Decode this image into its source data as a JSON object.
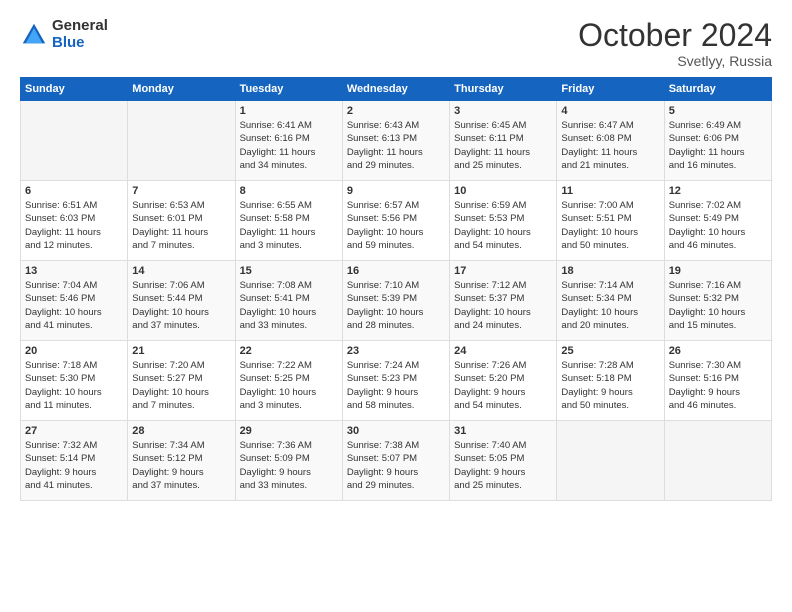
{
  "header": {
    "logo_general": "General",
    "logo_blue": "Blue",
    "month": "October 2024",
    "location": "Svetlyy, Russia"
  },
  "weekdays": [
    "Sunday",
    "Monday",
    "Tuesday",
    "Wednesday",
    "Thursday",
    "Friday",
    "Saturday"
  ],
  "weeks": [
    [
      {
        "day": "",
        "sunrise": "",
        "sunset": "",
        "daylight": ""
      },
      {
        "day": "",
        "sunrise": "",
        "sunset": "",
        "daylight": ""
      },
      {
        "day": "1",
        "sunrise": "Sunrise: 6:41 AM",
        "sunset": "Sunset: 6:16 PM",
        "daylight": "Daylight: 11 hours and 34 minutes."
      },
      {
        "day": "2",
        "sunrise": "Sunrise: 6:43 AM",
        "sunset": "Sunset: 6:13 PM",
        "daylight": "Daylight: 11 hours and 29 minutes."
      },
      {
        "day": "3",
        "sunrise": "Sunrise: 6:45 AM",
        "sunset": "Sunset: 6:11 PM",
        "daylight": "Daylight: 11 hours and 25 minutes."
      },
      {
        "day": "4",
        "sunrise": "Sunrise: 6:47 AM",
        "sunset": "Sunset: 6:08 PM",
        "daylight": "Daylight: 11 hours and 21 minutes."
      },
      {
        "day": "5",
        "sunrise": "Sunrise: 6:49 AM",
        "sunset": "Sunset: 6:06 PM",
        "daylight": "Daylight: 11 hours and 16 minutes."
      }
    ],
    [
      {
        "day": "6",
        "sunrise": "Sunrise: 6:51 AM",
        "sunset": "Sunset: 6:03 PM",
        "daylight": "Daylight: 11 hours and 12 minutes."
      },
      {
        "day": "7",
        "sunrise": "Sunrise: 6:53 AM",
        "sunset": "Sunset: 6:01 PM",
        "daylight": "Daylight: 11 hours and 7 minutes."
      },
      {
        "day": "8",
        "sunrise": "Sunrise: 6:55 AM",
        "sunset": "Sunset: 5:58 PM",
        "daylight": "Daylight: 11 hours and 3 minutes."
      },
      {
        "day": "9",
        "sunrise": "Sunrise: 6:57 AM",
        "sunset": "Sunset: 5:56 PM",
        "daylight": "Daylight: 10 hours and 59 minutes."
      },
      {
        "day": "10",
        "sunrise": "Sunrise: 6:59 AM",
        "sunset": "Sunset: 5:53 PM",
        "daylight": "Daylight: 10 hours and 54 minutes."
      },
      {
        "day": "11",
        "sunrise": "Sunrise: 7:00 AM",
        "sunset": "Sunset: 5:51 PM",
        "daylight": "Daylight: 10 hours and 50 minutes."
      },
      {
        "day": "12",
        "sunrise": "Sunrise: 7:02 AM",
        "sunset": "Sunset: 5:49 PM",
        "daylight": "Daylight: 10 hours and 46 minutes."
      }
    ],
    [
      {
        "day": "13",
        "sunrise": "Sunrise: 7:04 AM",
        "sunset": "Sunset: 5:46 PM",
        "daylight": "Daylight: 10 hours and 41 minutes."
      },
      {
        "day": "14",
        "sunrise": "Sunrise: 7:06 AM",
        "sunset": "Sunset: 5:44 PM",
        "daylight": "Daylight: 10 hours and 37 minutes."
      },
      {
        "day": "15",
        "sunrise": "Sunrise: 7:08 AM",
        "sunset": "Sunset: 5:41 PM",
        "daylight": "Daylight: 10 hours and 33 minutes."
      },
      {
        "day": "16",
        "sunrise": "Sunrise: 7:10 AM",
        "sunset": "Sunset: 5:39 PM",
        "daylight": "Daylight: 10 hours and 28 minutes."
      },
      {
        "day": "17",
        "sunrise": "Sunrise: 7:12 AM",
        "sunset": "Sunset: 5:37 PM",
        "daylight": "Daylight: 10 hours and 24 minutes."
      },
      {
        "day": "18",
        "sunrise": "Sunrise: 7:14 AM",
        "sunset": "Sunset: 5:34 PM",
        "daylight": "Daylight: 10 hours and 20 minutes."
      },
      {
        "day": "19",
        "sunrise": "Sunrise: 7:16 AM",
        "sunset": "Sunset: 5:32 PM",
        "daylight": "Daylight: 10 hours and 15 minutes."
      }
    ],
    [
      {
        "day": "20",
        "sunrise": "Sunrise: 7:18 AM",
        "sunset": "Sunset: 5:30 PM",
        "daylight": "Daylight: 10 hours and 11 minutes."
      },
      {
        "day": "21",
        "sunrise": "Sunrise: 7:20 AM",
        "sunset": "Sunset: 5:27 PM",
        "daylight": "Daylight: 10 hours and 7 minutes."
      },
      {
        "day": "22",
        "sunrise": "Sunrise: 7:22 AM",
        "sunset": "Sunset: 5:25 PM",
        "daylight": "Daylight: 10 hours and 3 minutes."
      },
      {
        "day": "23",
        "sunrise": "Sunrise: 7:24 AM",
        "sunset": "Sunset: 5:23 PM",
        "daylight": "Daylight: 9 hours and 58 minutes."
      },
      {
        "day": "24",
        "sunrise": "Sunrise: 7:26 AM",
        "sunset": "Sunset: 5:20 PM",
        "daylight": "Daylight: 9 hours and 54 minutes."
      },
      {
        "day": "25",
        "sunrise": "Sunrise: 7:28 AM",
        "sunset": "Sunset: 5:18 PM",
        "daylight": "Daylight: 9 hours and 50 minutes."
      },
      {
        "day": "26",
        "sunrise": "Sunrise: 7:30 AM",
        "sunset": "Sunset: 5:16 PM",
        "daylight": "Daylight: 9 hours and 46 minutes."
      }
    ],
    [
      {
        "day": "27",
        "sunrise": "Sunrise: 7:32 AM",
        "sunset": "Sunset: 5:14 PM",
        "daylight": "Daylight: 9 hours and 41 minutes."
      },
      {
        "day": "28",
        "sunrise": "Sunrise: 7:34 AM",
        "sunset": "Sunset: 5:12 PM",
        "daylight": "Daylight: 9 hours and 37 minutes."
      },
      {
        "day": "29",
        "sunrise": "Sunrise: 7:36 AM",
        "sunset": "Sunset: 5:09 PM",
        "daylight": "Daylight: 9 hours and 33 minutes."
      },
      {
        "day": "30",
        "sunrise": "Sunrise: 7:38 AM",
        "sunset": "Sunset: 5:07 PM",
        "daylight": "Daylight: 9 hours and 29 minutes."
      },
      {
        "day": "31",
        "sunrise": "Sunrise: 7:40 AM",
        "sunset": "Sunset: 5:05 PM",
        "daylight": "Daylight: 9 hours and 25 minutes."
      },
      {
        "day": "",
        "sunrise": "",
        "sunset": "",
        "daylight": ""
      },
      {
        "day": "",
        "sunrise": "",
        "sunset": "",
        "daylight": ""
      }
    ]
  ]
}
